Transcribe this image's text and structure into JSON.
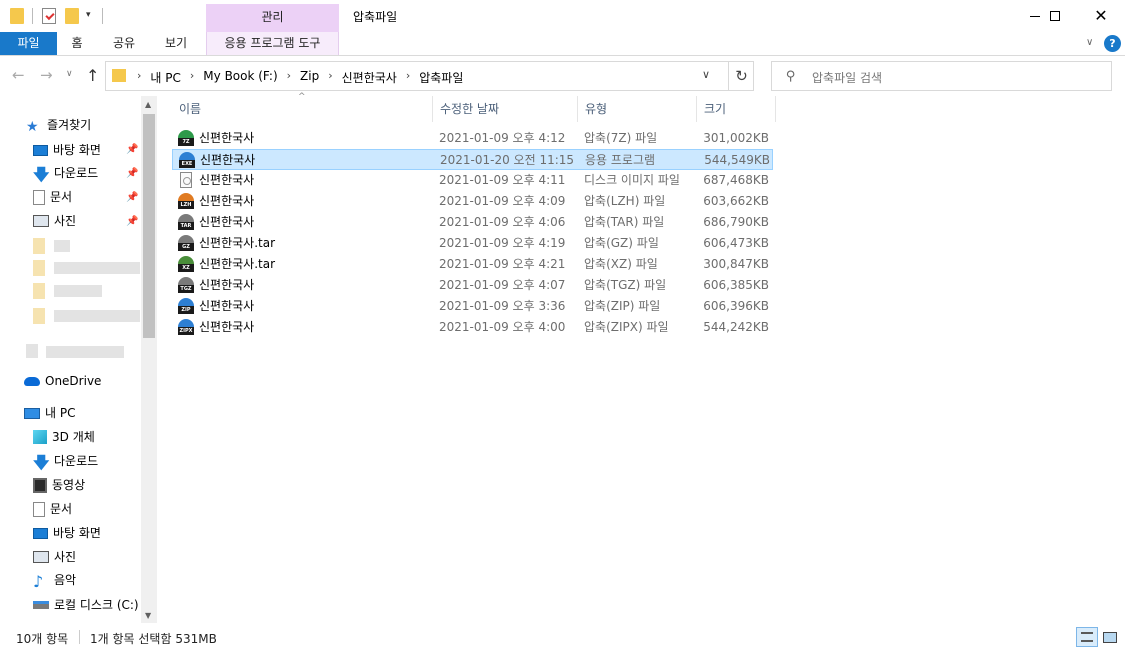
{
  "window": {
    "title": "압축파일",
    "tool_tab_header": "관리",
    "close_glyph": "✕"
  },
  "ribbon": {
    "tabs": [
      "파일",
      "홈",
      "공유",
      "보기",
      "응용 프로그램 도구"
    ],
    "collapse_glyph": "∨",
    "help_glyph": "?"
  },
  "nav": {
    "back": "←",
    "forward": "→",
    "recent": "∨",
    "up": "↑",
    "breadcrumbs": [
      "내 PC",
      "My Book (F:)",
      "Zip",
      "신편한국사",
      "압축파일"
    ],
    "crumb_separator": "›",
    "dropdown_glyph": "∨",
    "refresh_glyph": "↻"
  },
  "search": {
    "placeholder": "압축파일 검색",
    "icon_glyph": "⚲"
  },
  "sidebar": {
    "quick_access": "즐겨찾기",
    "pinned": [
      {
        "label": "바탕 화면",
        "icon": "desktop-icon"
      },
      {
        "label": "다운로드",
        "icon": "download-icon"
      },
      {
        "label": "문서",
        "icon": "document-icon"
      },
      {
        "label": "사진",
        "icon": "pictures-icon"
      }
    ],
    "pin_glyph": "📌",
    "onedrive": "OneDrive",
    "this_pc": "내 PC",
    "pc_items": [
      {
        "label": "3D 개체",
        "icon": "3d-objects-icon"
      },
      {
        "label": "다운로드",
        "icon": "download-icon"
      },
      {
        "label": "동영상",
        "icon": "videos-icon"
      },
      {
        "label": "문서",
        "icon": "document-icon"
      },
      {
        "label": "바탕 화면",
        "icon": "desktop-icon"
      },
      {
        "label": "사진",
        "icon": "pictures-icon"
      },
      {
        "label": "음악",
        "icon": "music-icon"
      },
      {
        "label": "로컬 디스크 (C:)",
        "icon": "drive-icon"
      }
    ],
    "star_glyph": "★",
    "arrow_glyph": "🡇",
    "note_glyph": "♪"
  },
  "columns": {
    "name": "이름",
    "date": "수정한 날짜",
    "type": "유형",
    "size": "크기",
    "sort_glyph": "^"
  },
  "files": [
    {
      "name": "신편한국사",
      "date": "2021-01-09 오후 4:12",
      "type": "압축(7Z) 파일",
      "size": "301,002KB",
      "badge": "7Z",
      "color": "#2e9a4a",
      "selected": false
    },
    {
      "name": "신편한국사",
      "date": "2021-01-20 오전 11:15",
      "type": "응용 프로그램",
      "size": "544,549KB",
      "badge": "EXE",
      "color": "#2d7fd3",
      "selected": true
    },
    {
      "name": "신편한국사",
      "date": "2021-01-09 오후 4:11",
      "type": "디스크 이미지 파일",
      "size": "687,468KB",
      "badge": "ISO",
      "color": "#999999",
      "selected": false
    },
    {
      "name": "신편한국사",
      "date": "2021-01-09 오후 4:09",
      "type": "압축(LZH) 파일",
      "size": "603,662KB",
      "badge": "LZH",
      "color": "#e07b22",
      "selected": false
    },
    {
      "name": "신편한국사",
      "date": "2021-01-09 오후 4:06",
      "type": "압축(TAR) 파일",
      "size": "686,790KB",
      "badge": "TAR",
      "color": "#7a7a7a",
      "selected": false
    },
    {
      "name": "신편한국사.tar",
      "date": "2021-01-09 오후 4:19",
      "type": "압축(GZ) 파일",
      "size": "606,473KB",
      "badge": "GZ",
      "color": "#7a7a7a",
      "selected": false
    },
    {
      "name": "신편한국사.tar",
      "date": "2021-01-09 오후 4:21",
      "type": "압축(XZ) 파일",
      "size": "300,847KB",
      "badge": "XZ",
      "color": "#4a8e3a",
      "selected": false
    },
    {
      "name": "신편한국사",
      "date": "2021-01-09 오후 4:07",
      "type": "압축(TGZ) 파일",
      "size": "606,385KB",
      "badge": "TGZ",
      "color": "#7a7a7a",
      "selected": false
    },
    {
      "name": "신편한국사",
      "date": "2021-01-09 오후 3:36",
      "type": "압축(ZIP) 파일",
      "size": "606,396KB",
      "badge": "ZIP",
      "color": "#2d7fd3",
      "selected": false
    },
    {
      "name": "신편한국사",
      "date": "2021-01-09 오후 4:00",
      "type": "압축(ZIPX) 파일",
      "size": "544,242KB",
      "badge": "ZIPX",
      "color": "#2d7fd3",
      "selected": false
    }
  ],
  "status": {
    "item_count": "10개 항목",
    "selection": "1개 항목 선택함 531MB"
  }
}
